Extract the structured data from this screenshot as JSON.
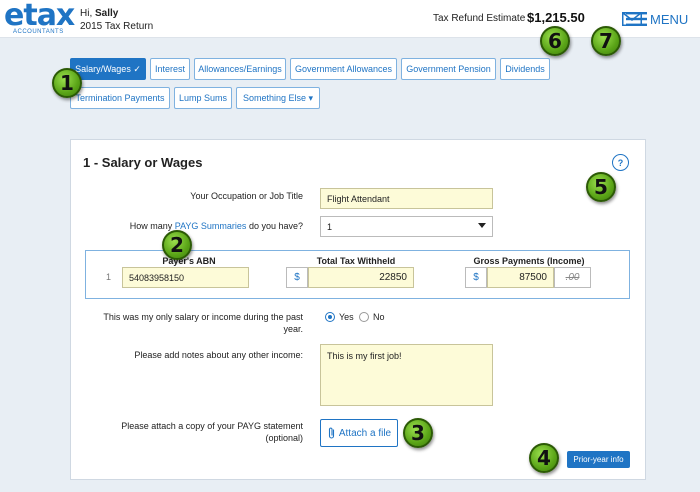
{
  "brand": {
    "logo": "etax",
    "logo_sub": "ACCOUNTANTS"
  },
  "header": {
    "greeting_prefix": "Hi,",
    "user_name": "Sally",
    "return_label": "2015 Tax Return",
    "refund_label": "Tax Refund Estimate",
    "refund_amount": "$1,215.50",
    "mail_icon": "mail-icon",
    "menu_label": "MENU"
  },
  "tabs": [
    {
      "label": "Salary/Wages ✓",
      "active": true
    },
    {
      "label": "Interest"
    },
    {
      "label": "Allowances/Earnings"
    },
    {
      "label": "Government Allowances"
    },
    {
      "label": "Government Pension"
    },
    {
      "label": "Dividends"
    },
    {
      "label": "Termination Payments"
    },
    {
      "label": "Lump Sums"
    },
    {
      "label": "Something Else ▾"
    }
  ],
  "badges": [
    "1",
    "2",
    "3",
    "4",
    "5",
    "6",
    "7"
  ],
  "form": {
    "title": "1 - Salary or Wages",
    "help": "?",
    "occupation_label": "Your Occupation or Job Title",
    "occupation_value": "Flight Attendant",
    "payg_prefix": "How many",
    "payg_link": "PAYG Summaries",
    "payg_suffix": "do you have?",
    "payg_count": "1",
    "columns": {
      "abn": "Payer's ABN",
      "tax": "Total Tax Withheld",
      "gross": "Gross Payments (Income)"
    },
    "row": {
      "num": "1",
      "abn": "54083958150",
      "currency": "$",
      "tax": "22850",
      "gross": "87500",
      "cents": ".00"
    },
    "only_income_label": "This was my only salary or income during the past year.",
    "yes_label": "Yes",
    "no_label": "No",
    "notes_label": "Please add notes about any other income:",
    "notes_value": "This is my first job!",
    "attach_label": "Please attach a copy of your PAYG statement (optional)",
    "attach_button": "Attach a file",
    "prior_button": "Prior-year info"
  },
  "colors": {
    "accent": "#1f74c4",
    "field": "#fdfbd8",
    "badge": "#5aa417",
    "background": "#e8eef4"
  }
}
